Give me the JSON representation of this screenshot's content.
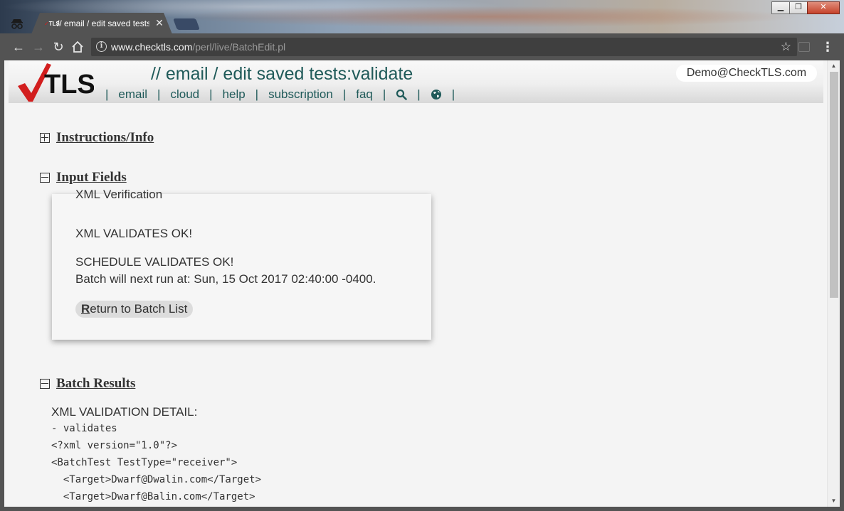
{
  "browser": {
    "tab_title": "// email / edit saved tests:validate",
    "tab_favicon_text": "TLS",
    "url_host": "www.checktls.com",
    "url_path": "/perl/live/BatchEdit.pl"
  },
  "header": {
    "title": "// email / edit saved tests:validate",
    "user": "Demo@CheckTLS.com",
    "logo_text": "TLS",
    "nav": [
      {
        "label": "email"
      },
      {
        "label": "cloud"
      },
      {
        "label": "help"
      },
      {
        "label": "subscription"
      },
      {
        "label": "faq"
      }
    ]
  },
  "sections": {
    "instructions": "Instructions/Info",
    "input_fields": "Input Fields",
    "batch_results": "Batch Results"
  },
  "verification": {
    "legend": "XML Verification",
    "xml_status": "XML VALIDATES OK!",
    "schedule_status": "SCHEDULE VALIDATES OK!",
    "next_run": "Batch will next run at: Sun, 15 Oct 2017 02:40:00 -0400.",
    "return_button_accel": "R",
    "return_button_rest": "eturn to Batch List"
  },
  "results": {
    "detail_title": "XML VALIDATION DETAIL:",
    "lines": [
      "- validates",
      "<?xml version=\"1.0\"?>",
      "<BatchTest TestType=\"receiver\">",
      "  <Target>Dwarf@Dwalin.com</Target>",
      "  <Target>Dwarf@Balin.com</Target>"
    ]
  },
  "colors": {
    "heading_teal": "#1f5a59",
    "logo_check_red": "#d21e1e"
  }
}
